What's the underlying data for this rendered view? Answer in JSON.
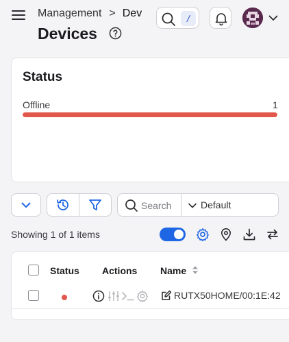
{
  "header": {
    "breadcrumb_parent": "Management",
    "breadcrumb_current": "Dev",
    "title": "Devices",
    "search_shortcut": "/"
  },
  "status": {
    "title": "Status",
    "label": "Offline",
    "count": "1",
    "fill_fraction": 1.0,
    "bar_color": "#e2574c"
  },
  "toolbar": {
    "search_placeholder": "Search",
    "view_selected": "Default"
  },
  "summary": {
    "showing_text": "Showing 1 of 1 items",
    "toggle_on": true,
    "accent_color": "#1f66e5"
  },
  "table": {
    "columns": [
      "Status",
      "Actions",
      "Name"
    ],
    "rows": [
      {
        "status": "offline",
        "name": "RUTX50HOME/00:1E:42"
      }
    ]
  }
}
